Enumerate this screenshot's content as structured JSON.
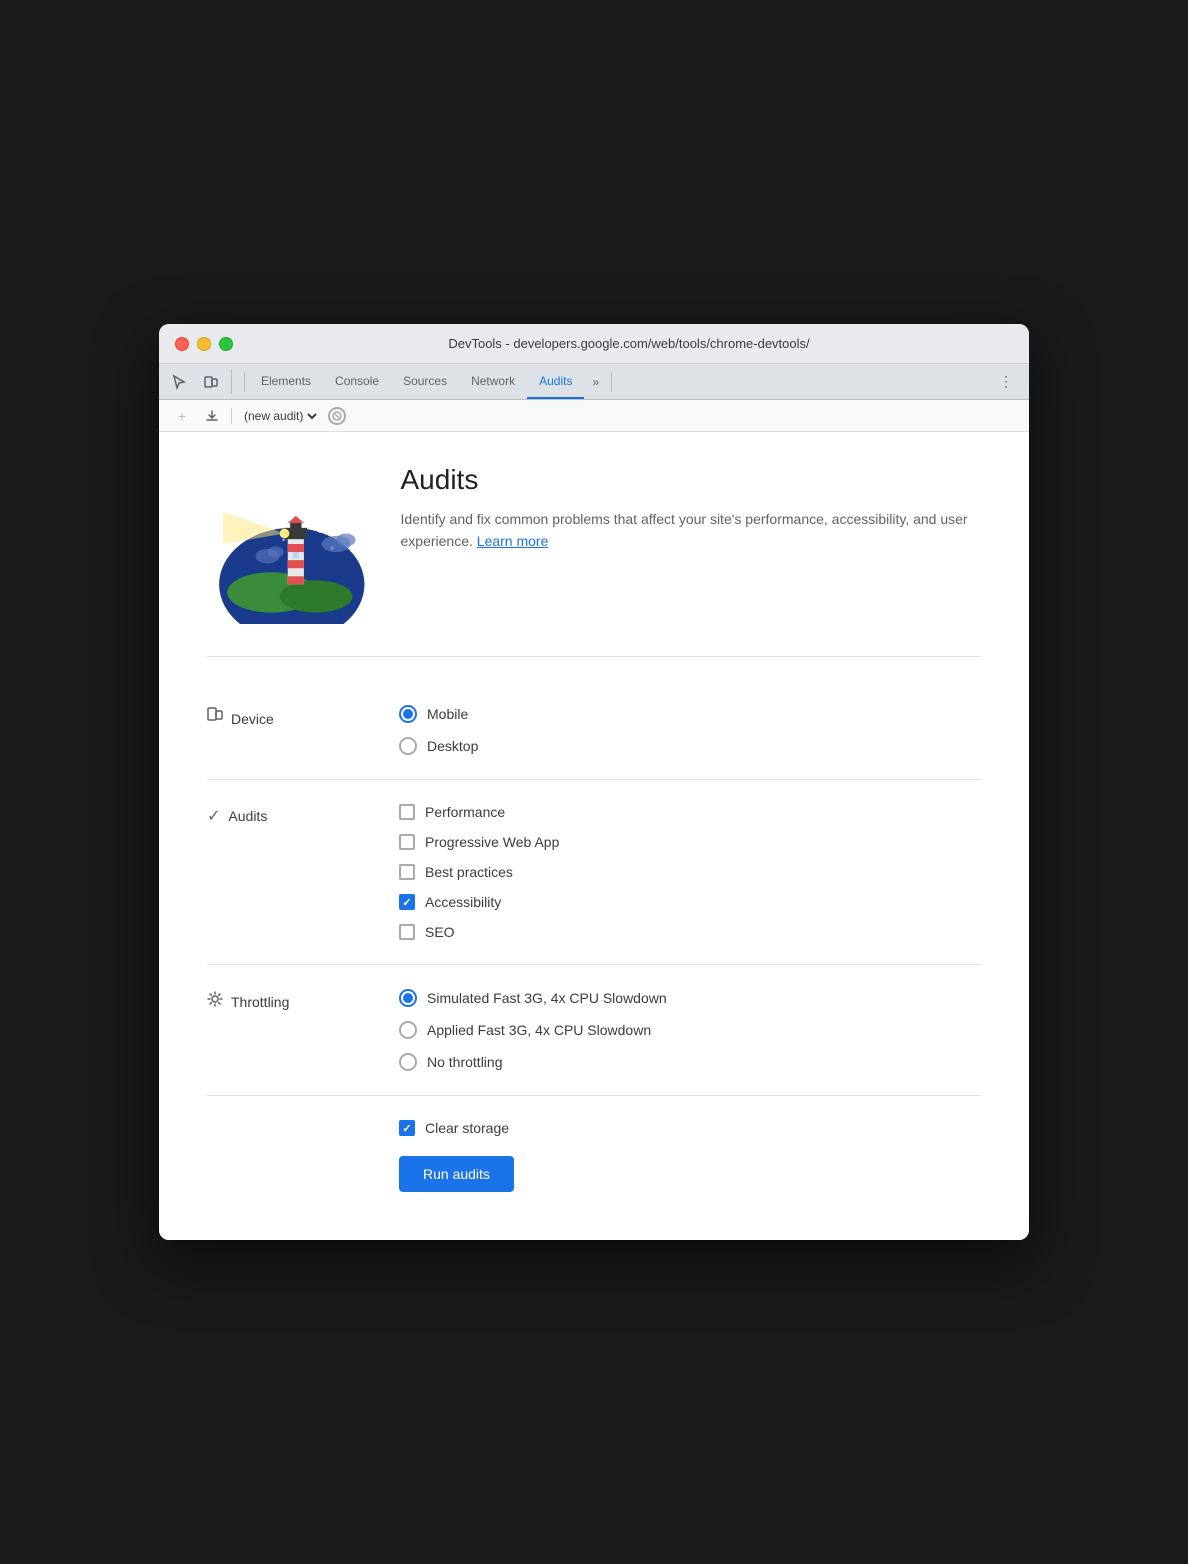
{
  "window": {
    "title": "DevTools - developers.google.com/web/tools/chrome-devtools/"
  },
  "tabs": {
    "elements": "Elements",
    "console": "Console",
    "sources": "Sources",
    "network": "Network",
    "audits": "Audits",
    "more": "»",
    "menu": "⋮"
  },
  "toolbar": {
    "new_audit_placeholder": "(new audit)",
    "stop_title": "Stop"
  },
  "hero": {
    "title": "Audits",
    "description": "Identify and fix common problems that affect your site's performance, accessibility, and user experience.",
    "learn_more": "Learn more"
  },
  "device": {
    "label": "Device",
    "options": [
      "Mobile",
      "Desktop"
    ],
    "selected": "Mobile"
  },
  "audits_section": {
    "label": "Audits",
    "options": [
      {
        "label": "Performance",
        "checked": false
      },
      {
        "label": "Progressive Web App",
        "checked": false
      },
      {
        "label": "Best practices",
        "checked": false
      },
      {
        "label": "Accessibility",
        "checked": true
      },
      {
        "label": "SEO",
        "checked": false
      }
    ]
  },
  "throttling": {
    "label": "Throttling",
    "options": [
      {
        "label": "Simulated Fast 3G, 4x CPU Slowdown",
        "selected": true
      },
      {
        "label": "Applied Fast 3G, 4x CPU Slowdown",
        "selected": false
      },
      {
        "label": "No throttling",
        "selected": false
      }
    ]
  },
  "clear_storage": {
    "label": "Clear storage",
    "checked": true
  },
  "run_button": "Run audits"
}
